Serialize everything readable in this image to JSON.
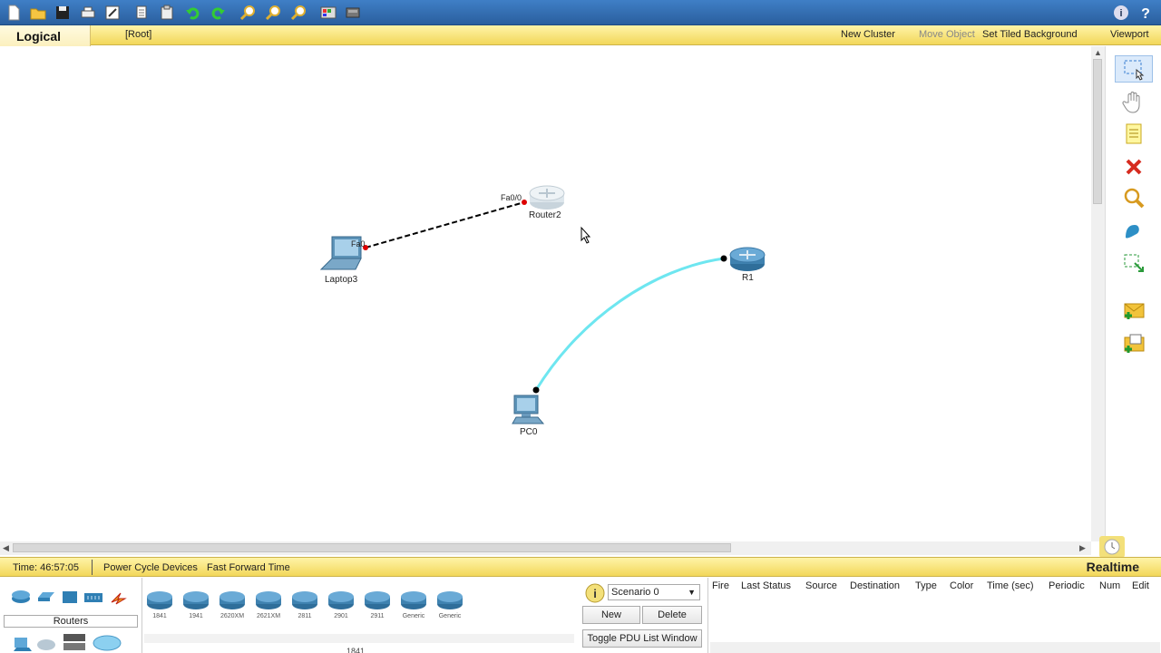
{
  "toolbar": {
    "buttons": [
      "new-file-icon",
      "open-folder-icon",
      "save-icon",
      "print-icon",
      "activity-wizard-icon",
      "copy-icon",
      "paste-icon",
      "undo-icon",
      "redo-icon",
      "zoom-in-icon",
      "zoom-reset-icon",
      "zoom-out-icon",
      "palette-icon",
      "custom-devices-icon"
    ],
    "right_buttons": [
      "info-icon",
      "help-icon"
    ]
  },
  "logical_bar": {
    "title": "Logical",
    "root": "[Root]",
    "new_cluster": "New Cluster",
    "move_object": "Move Object",
    "set_tiled_background": "Set Tiled Background",
    "viewport": "Viewport"
  },
  "canvas": {
    "devices": [
      {
        "name": "Router2",
        "type": "router"
      },
      {
        "name": "R1",
        "type": "router"
      },
      {
        "name": "Laptop3",
        "type": "laptop"
      },
      {
        "name": "PC0",
        "type": "pc"
      }
    ],
    "ports": {
      "router2_port": "Fa0/0",
      "laptop3_port": "Fa0"
    },
    "links": [
      {
        "from": "Laptop3",
        "to": "Router2",
        "type": "crossover",
        "color": "#000000"
      },
      {
        "from": "PC0",
        "to": "R1",
        "type": "console",
        "color": "#6ee6f0"
      }
    ]
  },
  "palette": [
    "select-icon",
    "hand-icon",
    "note-icon",
    "delete-icon",
    "inspect-icon",
    "draw-shape-icon",
    "resize-icon",
    "add-simple-pdu-icon",
    "add-complex-pdu-icon"
  ],
  "statusbar": {
    "time": "Time: 46:57:05",
    "power_cycle": "Power Cycle Devices",
    "fast_forward": "Fast Forward Time",
    "mode": "Realtime"
  },
  "bottom": {
    "device_type_label": "Routers",
    "devices": [
      "1841",
      "1941",
      "2620XM",
      "2621XM",
      "2811",
      "2901",
      "2911",
      "Generic",
      "Generic"
    ],
    "selected_model": "1841",
    "scenario": "Scenario 0",
    "new_label": "New",
    "delete_label": "Delete",
    "toggle_pdu": "Toggle PDU List Window",
    "pdu_columns": [
      "Fire",
      "Last Status",
      "Source",
      "Destination",
      "Type",
      "Color",
      "Time (sec)",
      "Periodic",
      "Num",
      "Edit"
    ]
  },
  "colors": {
    "toolbar": "#3f7fc6",
    "yellow_bar": "#f2d75a",
    "console_cable": "#6ee6f0",
    "router_blue": "#4a8fc0"
  }
}
